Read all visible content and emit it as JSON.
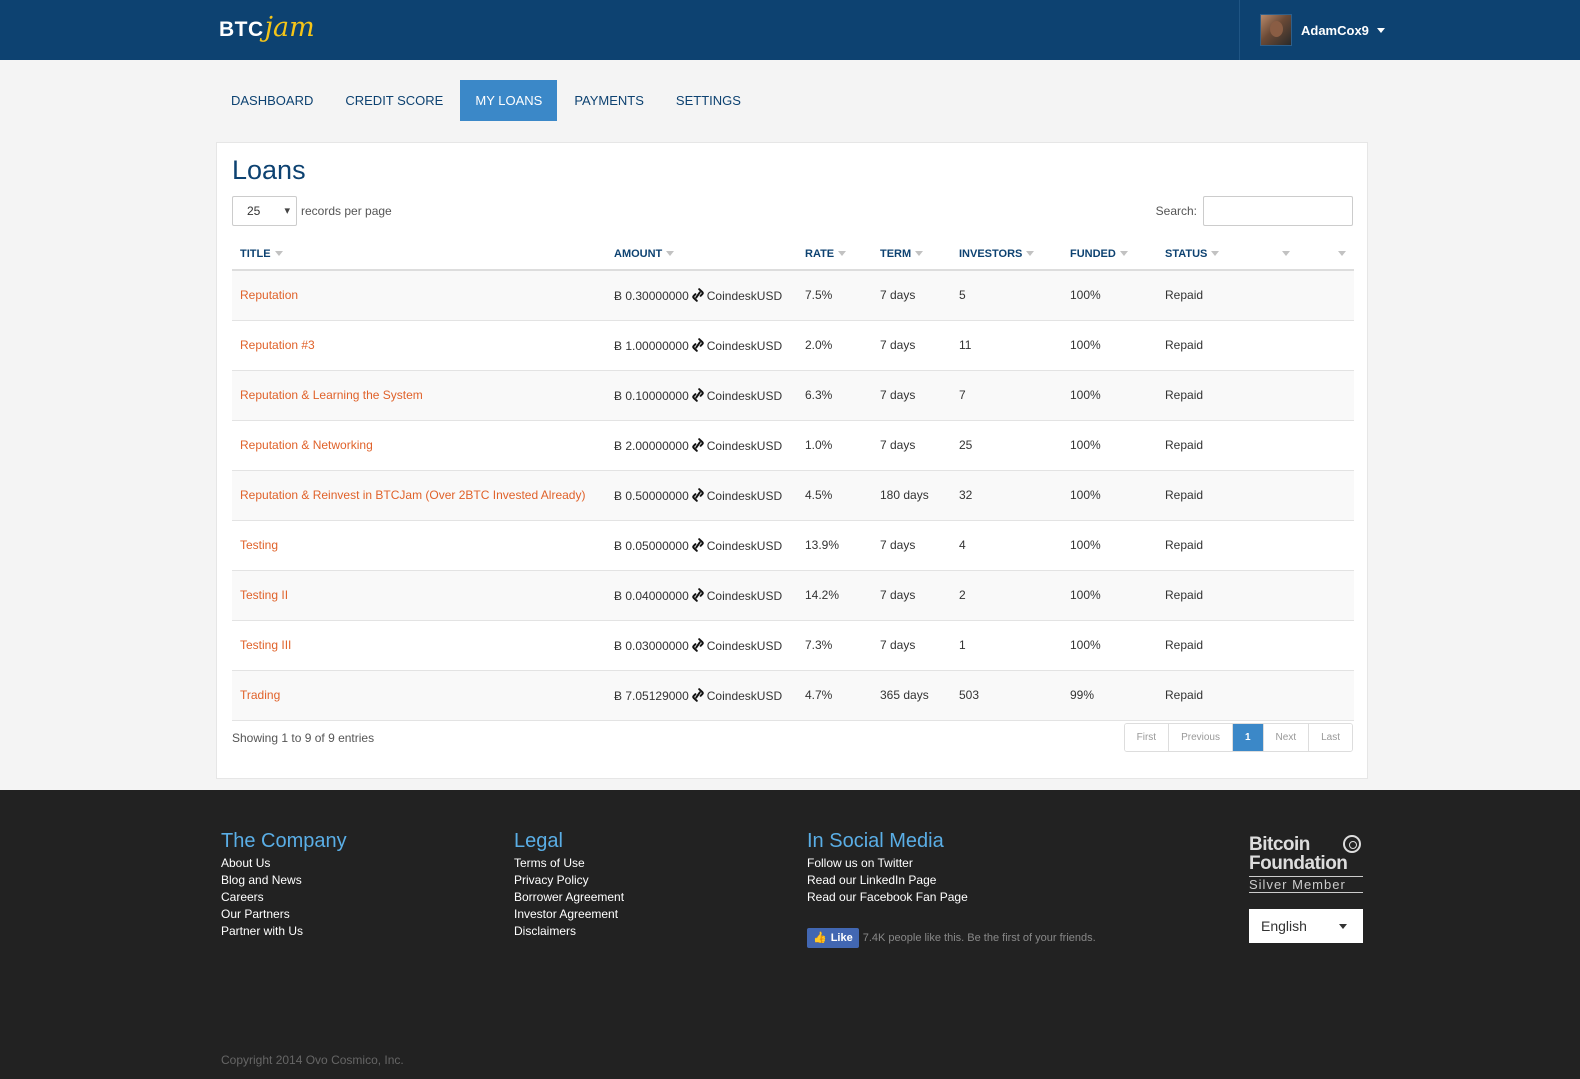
{
  "header": {
    "logo_btc": "BTC",
    "logo_jam": "jam",
    "username": "AdamCox9"
  },
  "nav": {
    "tabs": [
      "Dashboard",
      "Credit Score",
      "My Loans",
      "Payments",
      "Settings"
    ],
    "active": "My Loans"
  },
  "loans": {
    "title": "Loans",
    "per_page_value": "25",
    "per_page_label": "records per page",
    "search_label": "Search:",
    "search_value": "",
    "columns": [
      "Title",
      "Amount",
      "Rate",
      "Term",
      "Investors",
      "Funded",
      "Status",
      "",
      ""
    ],
    "currency_symbol": "Ƀ",
    "rate_source": "CoindeskUSD",
    "rows": [
      {
        "title": "Reputation",
        "amount": "0.30000000",
        "rate": "7.5%",
        "term": "7 days",
        "investors": "5",
        "funded": "100%",
        "status": "Repaid"
      },
      {
        "title": "Reputation #3",
        "amount": "1.00000000",
        "rate": "2.0%",
        "term": "7 days",
        "investors": "11",
        "funded": "100%",
        "status": "Repaid"
      },
      {
        "title": "Reputation & Learning the System",
        "amount": "0.10000000",
        "rate": "6.3%",
        "term": "7 days",
        "investors": "7",
        "funded": "100%",
        "status": "Repaid"
      },
      {
        "title": "Reputation & Networking",
        "amount": "2.00000000",
        "rate": "1.0%",
        "term": "7 days",
        "investors": "25",
        "funded": "100%",
        "status": "Repaid"
      },
      {
        "title": "Reputation & Reinvest in BTCJam (Over 2BTC Invested Already)",
        "amount": "0.50000000",
        "rate": "4.5%",
        "term": "180 days",
        "investors": "32",
        "funded": "100%",
        "status": "Repaid"
      },
      {
        "title": "Testing",
        "amount": "0.05000000",
        "rate": "13.9%",
        "term": "7 days",
        "investors": "4",
        "funded": "100%",
        "status": "Repaid"
      },
      {
        "title": "Testing II",
        "amount": "0.04000000",
        "rate": "14.2%",
        "term": "7 days",
        "investors": "2",
        "funded": "100%",
        "status": "Repaid"
      },
      {
        "title": "Testing III",
        "amount": "0.03000000",
        "rate": "7.3%",
        "term": "7 days",
        "investors": "1",
        "funded": "100%",
        "status": "Repaid"
      },
      {
        "title": "Trading",
        "amount": "7.05129000",
        "rate": "4.7%",
        "term": "365 days",
        "investors": "503",
        "funded": "99%",
        "status": "Repaid"
      }
    ],
    "info": "Showing 1 to 9 of 9 entries",
    "pager": [
      "First",
      "Previous",
      "1",
      "Next",
      "Last"
    ],
    "current_page": "1"
  },
  "footer": {
    "company": {
      "title": "The Company",
      "links": [
        "About Us",
        "Blog and News",
        "Careers",
        "Our Partners",
        "Partner with Us"
      ]
    },
    "legal": {
      "title": "Legal",
      "links": [
        "Terms of Use",
        "Privacy Policy",
        "Borrower Agreement",
        "Investor Agreement",
        "Disclaimers"
      ]
    },
    "social": {
      "title": "In Social Media",
      "links": [
        "Follow us on Twitter",
        "Read our LinkedIn Page",
        "Read our Facebook Fan Page"
      ]
    },
    "fb_like_label": "Like",
    "fb_like_text": "7.4K people like this. Be the first of your friends.",
    "badge_line1": "Bitcoin",
    "badge_line2": "Foundation",
    "badge_line3": "Silver Member",
    "language": "English",
    "copyright": "Copyright 2014 Ovo Cosmico, Inc."
  },
  "colors": {
    "header_bg": "#0d4271",
    "accent": "#3b88c8",
    "link": "#e0622a",
    "footer_bg": "#222222",
    "footer_heading": "#5aaee6"
  }
}
